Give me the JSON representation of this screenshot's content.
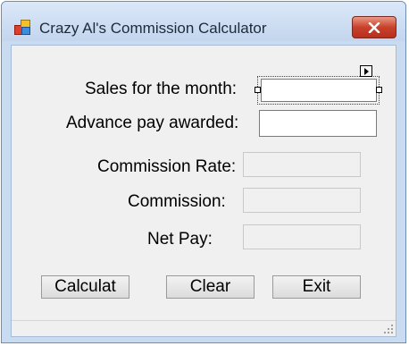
{
  "window": {
    "title": "Crazy Al's Commission Calculator",
    "close_icon": "close-icon",
    "app_icon": "app-blocks-icon"
  },
  "form": {
    "sales_label": "Sales for the month:",
    "sales_value": "",
    "advance_label": "Advance pay awarded:",
    "advance_value": "",
    "rate_label": "Commission Rate:",
    "rate_value": "",
    "commission_label": "Commission:",
    "commission_value": "",
    "netpay_label": "Net Pay:",
    "netpay_value": ""
  },
  "buttons": {
    "calculate": "Calculat",
    "clear": "Clear",
    "exit": "Exit"
  },
  "colors": {
    "close_button": "#c8412b",
    "client_background": "#f0f0f0"
  }
}
